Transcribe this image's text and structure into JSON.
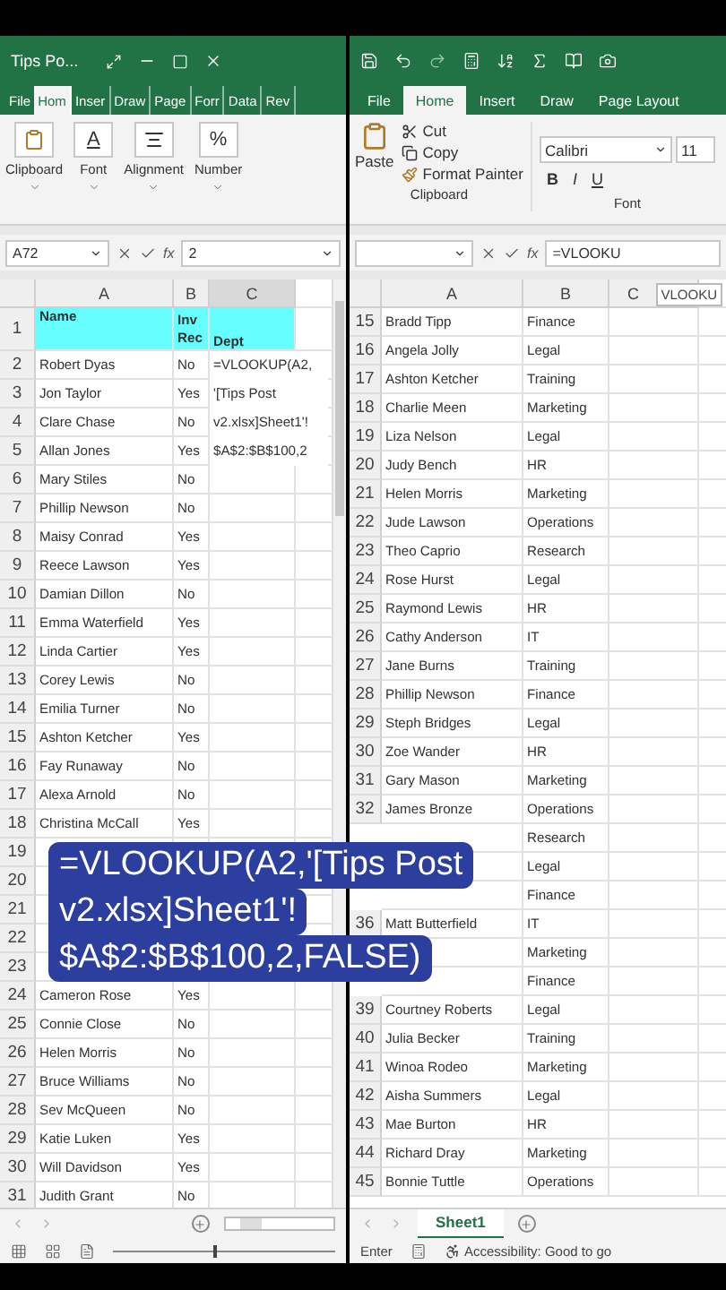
{
  "left_window": {
    "title": "Tips Po...",
    "tabs": [
      {
        "label": "File",
        "selected": false
      },
      {
        "label": "Hom",
        "selected": true
      },
      {
        "label": "Inser",
        "selected": false
      },
      {
        "label": "Draw",
        "selected": false
      },
      {
        "label": "Page",
        "selected": false
      },
      {
        "label": "Forr",
        "selected": false
      },
      {
        "label": "Data",
        "selected": false
      },
      {
        "label": "Rev",
        "selected": false
      }
    ],
    "ribbon_groups": [
      {
        "kind": "clipboard",
        "label": "Clipboard"
      },
      {
        "kind": "font",
        "label": "Font",
        "glyph": "A"
      },
      {
        "kind": "alignment",
        "label": "Alignment"
      },
      {
        "kind": "number",
        "label": "Number",
        "glyph": "%"
      }
    ],
    "name_box": "A72",
    "fx": "fx",
    "formula": "2",
    "columns": [
      "A",
      "B",
      "C"
    ],
    "header_row": {
      "number": "1",
      "name": "Name",
      "inv_rec": "Inv Rec",
      "dept": "Dept"
    },
    "cell_editor": [
      "=VLOOKUP(A2,",
      "'[Tips Post",
      "v2.xlsx]Sheet1'!",
      "$A$2:$B$100,2"
    ],
    "rows": [
      {
        "number": "2",
        "name": "Robert Dyas",
        "inv_rec": "No"
      },
      {
        "number": "3",
        "name": "Jon Taylor",
        "inv_rec": "Yes"
      },
      {
        "number": "4",
        "name": "Clare Chase",
        "inv_rec": "No"
      },
      {
        "number": "5",
        "name": "Allan Jones",
        "inv_rec": "Yes"
      },
      {
        "number": "6",
        "name": "Mary Stiles",
        "inv_rec": "No"
      },
      {
        "number": "7",
        "name": "Phillip Newson",
        "inv_rec": "No"
      },
      {
        "number": "8",
        "name": "Maisy Conrad",
        "inv_rec": "Yes"
      },
      {
        "number": "9",
        "name": "Reece Lawson",
        "inv_rec": "Yes"
      },
      {
        "number": "10",
        "name": "Damian Dillon",
        "inv_rec": "No"
      },
      {
        "number": "11",
        "name": "Emma Waterfield",
        "inv_rec": "Yes"
      },
      {
        "number": "12",
        "name": "Linda Cartier",
        "inv_rec": "Yes"
      },
      {
        "number": "13",
        "name": "Corey Lewis",
        "inv_rec": "No"
      },
      {
        "number": "14",
        "name": "Emilia Turner",
        "inv_rec": "No"
      },
      {
        "number": "15",
        "name": "Ashton Ketcher",
        "inv_rec": "Yes"
      },
      {
        "number": "16",
        "name": "Fay Runaway",
        "inv_rec": "No"
      },
      {
        "number": "17",
        "name": "Alexa Arnold",
        "inv_rec": "No"
      },
      {
        "number": "18",
        "name": "Christina McCall",
        "inv_rec": "Yes"
      },
      {
        "number": "19"
      },
      {
        "number": "20"
      },
      {
        "number": "21"
      },
      {
        "number": "22"
      },
      {
        "number": "23"
      },
      {
        "number": "24",
        "name": "Cameron Rose",
        "inv_rec": "Yes"
      },
      {
        "number": "25",
        "name": "Connie Close",
        "inv_rec": "No"
      },
      {
        "number": "26",
        "name": "Helen Morris",
        "inv_rec": "No"
      },
      {
        "number": "27",
        "name": "Bruce Williams",
        "inv_rec": "No"
      },
      {
        "number": "28",
        "name": "Sev McQueen",
        "inv_rec": "No"
      },
      {
        "number": "29",
        "name": "Katie Luken",
        "inv_rec": "Yes"
      },
      {
        "number": "30",
        "name": "Will Davidson",
        "inv_rec": "Yes"
      },
      {
        "number": "31",
        "name": "Judith Grant",
        "inv_rec": "No"
      }
    ],
    "zoom": {
      "level": 0.45
    }
  },
  "right_window": {
    "tabs": [
      {
        "label": "File",
        "selected": false
      },
      {
        "label": "Home",
        "selected": true
      },
      {
        "label": "Insert",
        "selected": false
      },
      {
        "label": "Draw",
        "selected": false
      },
      {
        "label": "Page Layout",
        "selected": false
      }
    ],
    "clipboard": {
      "paste": "Paste",
      "cut": "Cut",
      "copy": "Copy",
      "format_painter": "Format Painter",
      "label": "Clipboard"
    },
    "font": {
      "family": "Calibri",
      "size": "11",
      "bold": "B",
      "italic": "I",
      "underline": "U",
      "label": "Font"
    },
    "fx": "fx",
    "formula": "=VLOOKU",
    "columns": [
      "A",
      "B",
      "C"
    ],
    "tooltip": "VLOOKU",
    "rows": [
      {
        "number": "15",
        "name": "Bradd Tipp",
        "dept": "Finance"
      },
      {
        "number": "16",
        "name": "Angela Jolly",
        "dept": "Legal"
      },
      {
        "number": "17",
        "name": "Ashton Ketcher",
        "dept": "Training"
      },
      {
        "number": "18",
        "name": "Charlie Meen",
        "dept": "Marketing"
      },
      {
        "number": "19",
        "name": "Liza Nelson",
        "dept": "Legal"
      },
      {
        "number": "20",
        "name": "Judy Bench",
        "dept": "HR"
      },
      {
        "number": "21",
        "name": "Helen Morris",
        "dept": "Marketing"
      },
      {
        "number": "22",
        "name": "Jude Lawson",
        "dept": "Operations"
      },
      {
        "number": "23",
        "name": "Theo Caprio",
        "dept": "Research"
      },
      {
        "number": "24",
        "name": "Rose Hurst",
        "dept": "Legal"
      },
      {
        "number": "25",
        "name": "Raymond Lewis",
        "dept": "HR"
      },
      {
        "number": "26",
        "name": "Cathy Anderson",
        "dept": "IT"
      },
      {
        "number": "27",
        "name": "Jane Burns",
        "dept": "Training"
      },
      {
        "number": "28",
        "name": "Phillip Newson",
        "dept": "Finance"
      },
      {
        "number": "29",
        "name": "Steph Bridges",
        "dept": "Legal"
      },
      {
        "number": "30",
        "name": "Zoe Wander",
        "dept": "HR"
      },
      {
        "number": "31",
        "name": "Gary Mason",
        "dept": "Marketing"
      },
      {
        "number": "32",
        "name": "James Bronze",
        "dept": "Operations"
      },
      {
        "dept": "Research"
      },
      {
        "dept": "Legal"
      },
      {
        "dept": "Finance"
      },
      {
        "number": "36",
        "name": "Matt Butterfield",
        "dept": "IT"
      },
      {
        "dept": "Marketing"
      },
      {
        "dept": "Finance"
      },
      {
        "number": "39",
        "name": "Courtney Roberts",
        "dept": "Legal"
      },
      {
        "number": "40",
        "name": "Julia Becker",
        "dept": "Training"
      },
      {
        "number": "41",
        "name": "Winoa Rodeo",
        "dept": "Marketing"
      },
      {
        "number": "42",
        "name": "Aisha Summers",
        "dept": "Legal"
      },
      {
        "number": "43",
        "name": "Mae Burton",
        "dept": "HR"
      },
      {
        "number": "44",
        "name": "Richard Dray",
        "dept": "Marketing"
      },
      {
        "number": "45",
        "name": "Bonnie Tuttle",
        "dept": "Operations"
      }
    ],
    "sheet_tabs": [
      {
        "label": "Sheet1",
        "selected": true
      }
    ],
    "status": {
      "mode": "Enter",
      "accessibility": "Accessibility: Good to go"
    }
  },
  "caption": {
    "lines": [
      "=VLOOKUP(A2,'[Tips Post",
      "v2.xlsx]Sheet1'!",
      "$A$2:$B$100,2,FALSE)"
    ]
  }
}
